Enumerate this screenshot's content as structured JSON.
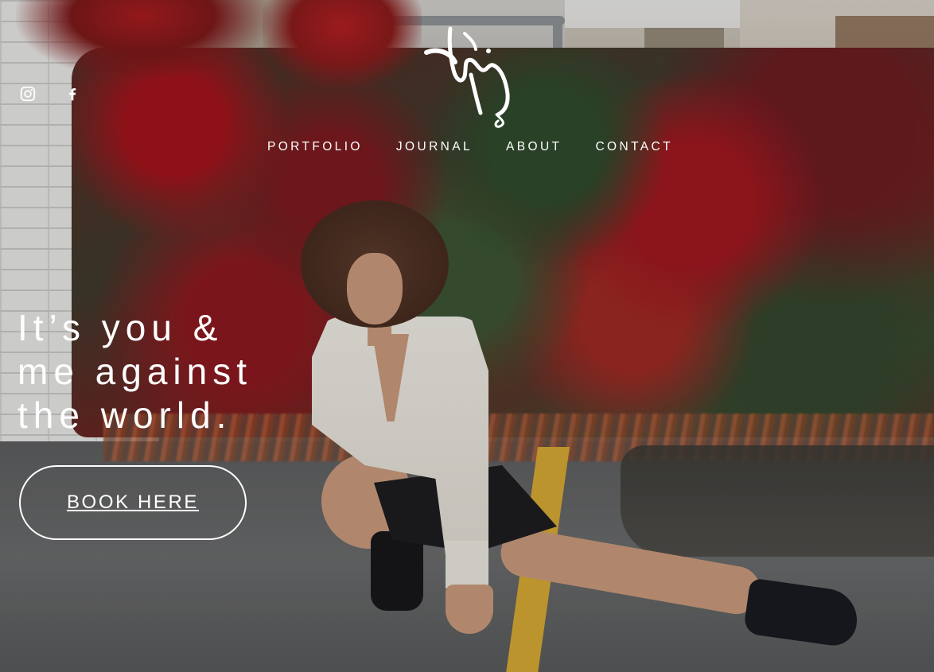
{
  "social": {
    "instagram_icon": "instagram-icon",
    "facebook_icon": "facebook-icon"
  },
  "logo": {
    "icon": "calligraphy-logo"
  },
  "nav": {
    "items": [
      {
        "label": "PORTFOLIO"
      },
      {
        "label": "JOURNAL"
      },
      {
        "label": "ABOUT"
      },
      {
        "label": "CONTACT"
      }
    ]
  },
  "hero": {
    "headline_lines": [
      "It’s you &",
      "me against",
      "the world."
    ],
    "cta_label": "BOOK HERE"
  },
  "colors": {
    "text": "#ffffff",
    "accent_line": "#d6a935"
  }
}
